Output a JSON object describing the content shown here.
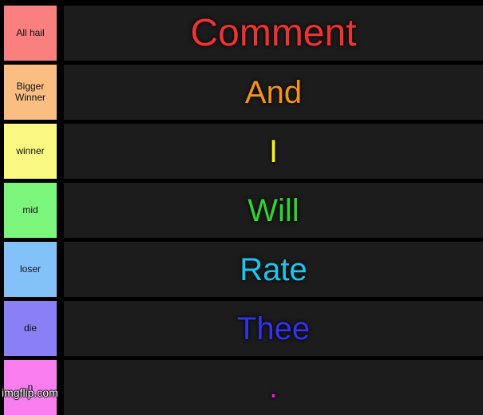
{
  "meta": {
    "watermark": "imgflip.com",
    "background_color": "#000000",
    "row_background_color": "#1c1c1c"
  },
  "rows": [
    {
      "label": "All hail",
      "label_color": "#fa7f7f",
      "text": "Comment",
      "text_color": "#f03232",
      "size": "size-xl"
    },
    {
      "label": "Bigger Winner",
      "label_color": "#fbbe82",
      "text": "And",
      "text_color": "#f59218",
      "size": "size-lg"
    },
    {
      "label": "winner",
      "label_color": "#f8f882",
      "text": "I",
      "text_color": "#f2f21e",
      "size": "size-lg"
    },
    {
      "label": "mid",
      "label_color": "#7bf57b",
      "text": "Will",
      "text_color": "#32d232",
      "size": "size-lg"
    },
    {
      "label": "loser",
      "label_color": "#82c2f8",
      "text": "Rate",
      "text_color": "#19c8f0",
      "size": "size-lg"
    },
    {
      "label": "die",
      "label_color": "#8a7ff5",
      "text": "Thee",
      "text_color": "#3232f0",
      "size": "size-lg"
    },
    {
      "label": "n",
      "label_color": "#f87ef0",
      "text": ".",
      "text_color": "#e619e6",
      "size": "size-md"
    }
  ]
}
